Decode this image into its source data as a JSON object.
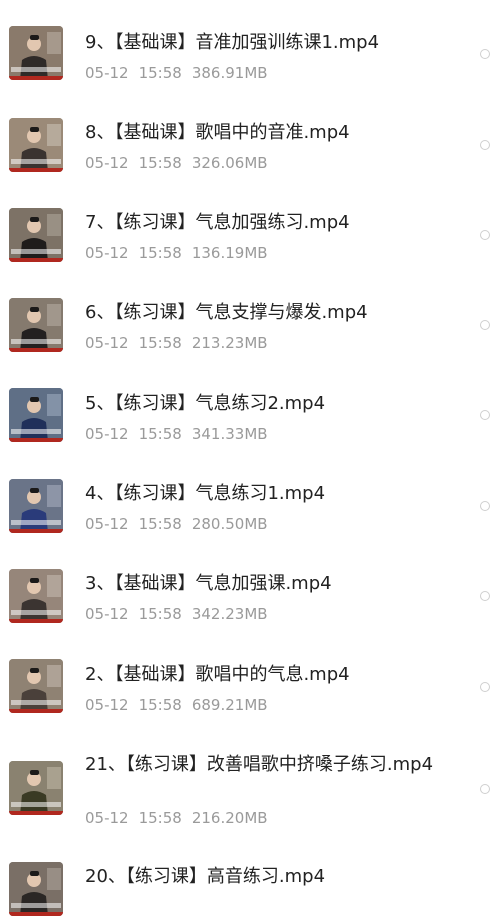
{
  "files": [
    {
      "name": "9、【基础课】音准加强训练课1.mp4",
      "date": "05-12",
      "time": "15:58",
      "size": "386.91MB",
      "thumb": {
        "bg": "#8a7a6b",
        "figure": "#2f2a28",
        "accent": "#d9d4cc"
      }
    },
    {
      "name": "8、【基础课】歌唱中的音准.mp4",
      "date": "05-12",
      "time": "15:58",
      "size": "326.06MB",
      "thumb": {
        "bg": "#9b8a78",
        "figure": "#3a3330",
        "accent": "#e9e4dc"
      }
    },
    {
      "name": "7、【练习课】气息加强练习.mp4",
      "date": "05-12",
      "time": "15:58",
      "size": "136.19MB",
      "thumb": {
        "bg": "#7d7266",
        "figure": "#1f1c1b",
        "accent": "#cfc8be"
      }
    },
    {
      "name": "6、【练习课】气息支撑与爆发.mp4",
      "date": "05-12",
      "time": "15:58",
      "size": "213.23MB",
      "thumb": {
        "bg": "#857a6e",
        "figure": "#232020",
        "accent": "#d6cfc6"
      }
    },
    {
      "name": "5、【练习课】气息练习2.mp4",
      "date": "05-12",
      "time": "15:58",
      "size": "341.33MB",
      "thumb": {
        "bg": "#5f6f86",
        "figure": "#20305a",
        "accent": "#c9d3e6"
      }
    },
    {
      "name": "4、【练习课】气息练习1.mp4",
      "date": "05-12",
      "time": "15:58",
      "size": "280.50MB",
      "thumb": {
        "bg": "#6a7488",
        "figure": "#2a3b7a",
        "accent": "#cdd4e2"
      }
    },
    {
      "name": "3、【基础课】气息加强课.mp4",
      "date": "05-12",
      "time": "15:58",
      "size": "342.23MB",
      "thumb": {
        "bg": "#96867a",
        "figure": "#3b3431",
        "accent": "#e6ddd3"
      }
    },
    {
      "name": "2、【基础课】歌唱中的气息.mp4",
      "date": "05-12",
      "time": "15:58",
      "size": "689.21MB",
      "thumb": {
        "bg": "#8f8273",
        "figure": "#4a403a",
        "accent": "#e8e0d6"
      }
    },
    {
      "name": "21、【练习课】改善唱歌中挤嗓子练习.mp4",
      "date": "05-12",
      "time": "15:58",
      "size": "216.20MB",
      "thumb": {
        "bg": "#8a8270",
        "figure": "#3a3a24",
        "accent": "#e2dcc8"
      }
    },
    {
      "name": "20、【练习课】高音练习.mp4",
      "date": "",
      "time": "",
      "size": "",
      "thumb": {
        "bg": "#7a6f66",
        "figure": "#2b2725",
        "accent": "#d0c9c0"
      }
    }
  ]
}
